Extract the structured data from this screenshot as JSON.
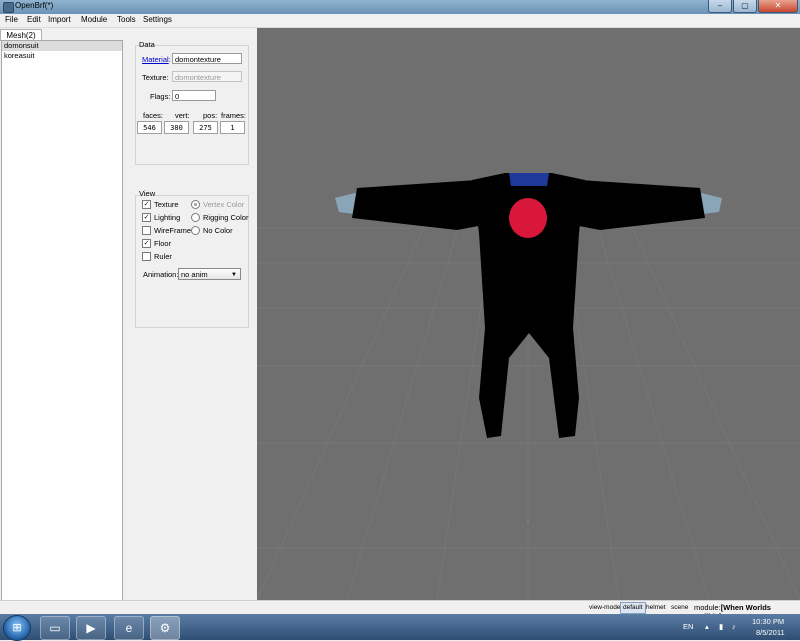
{
  "window": {
    "title": "OpenBrf(*)",
    "minimize": "–",
    "maximize": "▢",
    "close": "✕"
  },
  "menu": [
    "File",
    "Edit",
    "Import",
    "Module",
    "Tools",
    "Settings"
  ],
  "left_panel": {
    "tab": "Mesh(2)",
    "meshes": [
      "domonsuit",
      "koreasuit"
    ],
    "selected_index": 0
  },
  "data_group": {
    "title": "Data",
    "material_label": "Material",
    "material_colon": ":",
    "material_value": "domontexture",
    "texture_label": "Texture:",
    "texture_value": "domontexture",
    "flags_label": "Flags:",
    "flags_value": "0",
    "stats": [
      {
        "label": "faces:",
        "value": "546"
      },
      {
        "label": "vert:",
        "value": "380"
      },
      {
        "label": "pos:",
        "value": "275"
      },
      {
        "label": "frames:",
        "value": "1"
      }
    ]
  },
  "view_group": {
    "title": "View",
    "checks": [
      {
        "label": "Texture",
        "checked": true
      },
      {
        "label": "Lighting",
        "checked": true
      },
      {
        "label": "WireFrame",
        "checked": false
      },
      {
        "label": "Floor",
        "checked": true
      },
      {
        "label": "Ruler",
        "checked": false
      }
    ],
    "radios": [
      {
        "label": "Vertex Color",
        "selected": true,
        "disabled": true
      },
      {
        "label": "Rigging Color",
        "selected": false,
        "disabled": false
      },
      {
        "label": "No Color",
        "selected": false,
        "disabled": false
      }
    ],
    "animation_label": "Animation:",
    "animation_value": "no anim"
  },
  "statusbar": {
    "view_mode_label": "view-mode",
    "modes": [
      "default",
      "helmet",
      "scene"
    ],
    "active_mode": "default",
    "module_prefix": "module:",
    "module_name": "[When Worlds Collide]"
  },
  "taskbar": {
    "lang": "EN",
    "time": "10:30 PM",
    "date": "8/5/2011"
  },
  "colors": {
    "viewport_bg": "#6f6f6f",
    "suit": "#000000",
    "collar": "#1f3a9a",
    "chest_emblem": "#d8173a",
    "sleeve_cuff": "#8aa4b8"
  }
}
